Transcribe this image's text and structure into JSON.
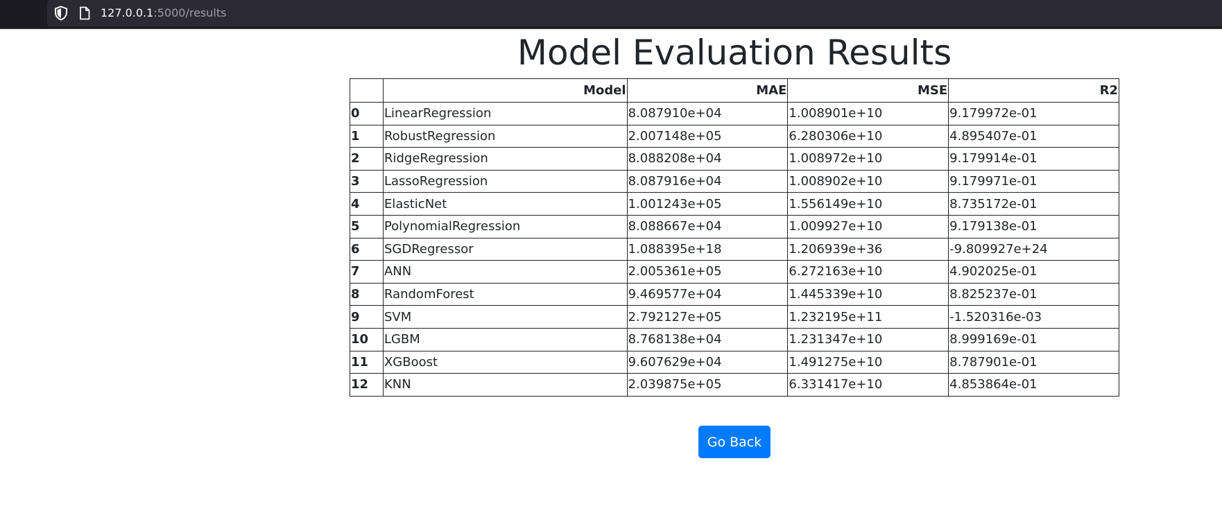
{
  "browser": {
    "url_host": "127.0.0.1",
    "url_path": ":5000/results"
  },
  "page": {
    "title": "Model Evaluation Results",
    "go_back_label": "Go Back"
  },
  "table": {
    "columns": [
      "",
      "Model",
      "MAE",
      "MSE",
      "R2"
    ],
    "rows": [
      {
        "index": "0",
        "model": "LinearRegression",
        "mae": "8.087910e+04",
        "mse": "1.008901e+10",
        "r2": "9.179972e-01"
      },
      {
        "index": "1",
        "model": "RobustRegression",
        "mae": "2.007148e+05",
        "mse": "6.280306e+10",
        "r2": "4.895407e-01"
      },
      {
        "index": "2",
        "model": "RidgeRegression",
        "mae": "8.088208e+04",
        "mse": "1.008972e+10",
        "r2": "9.179914e-01"
      },
      {
        "index": "3",
        "model": "LassoRegression",
        "mae": "8.087916e+04",
        "mse": "1.008902e+10",
        "r2": "9.179971e-01"
      },
      {
        "index": "4",
        "model": "ElasticNet",
        "mae": "1.001243e+05",
        "mse": "1.556149e+10",
        "r2": "8.735172e-01"
      },
      {
        "index": "5",
        "model": "PolynomialRegression",
        "mae": "8.088667e+04",
        "mse": "1.009927e+10",
        "r2": "9.179138e-01"
      },
      {
        "index": "6",
        "model": "SGDRegressor",
        "mae": "1.088395e+18",
        "mse": "1.206939e+36",
        "r2": "-9.809927e+24"
      },
      {
        "index": "7",
        "model": "ANN",
        "mae": "2.005361e+05",
        "mse": "6.272163e+10",
        "r2": "4.902025e-01"
      },
      {
        "index": "8",
        "model": "RandomForest",
        "mae": "9.469577e+04",
        "mse": "1.445339e+10",
        "r2": "8.825237e-01"
      },
      {
        "index": "9",
        "model": "SVM",
        "mae": "2.792127e+05",
        "mse": "1.232195e+11",
        "r2": "-1.520316e-03"
      },
      {
        "index": "10",
        "model": "LGBM",
        "mae": "8.768138e+04",
        "mse": "1.231347e+10",
        "r2": "8.999169e-01"
      },
      {
        "index": "11",
        "model": "XGBoost",
        "mae": "9.607629e+04",
        "mse": "1.491275e+10",
        "r2": "8.787901e-01"
      },
      {
        "index": "12",
        "model": "KNN",
        "mae": "2.039875e+05",
        "mse": "6.331417e+10",
        "r2": "4.853864e-01"
      }
    ]
  },
  "icons": {
    "tracking_protection": "shield-icon",
    "page_info": "page-icon"
  },
  "colors": {
    "browser_bar": "#1c1b22",
    "url_box": "#2b2a33",
    "button_primary": "#007bff",
    "text": "#212529"
  }
}
